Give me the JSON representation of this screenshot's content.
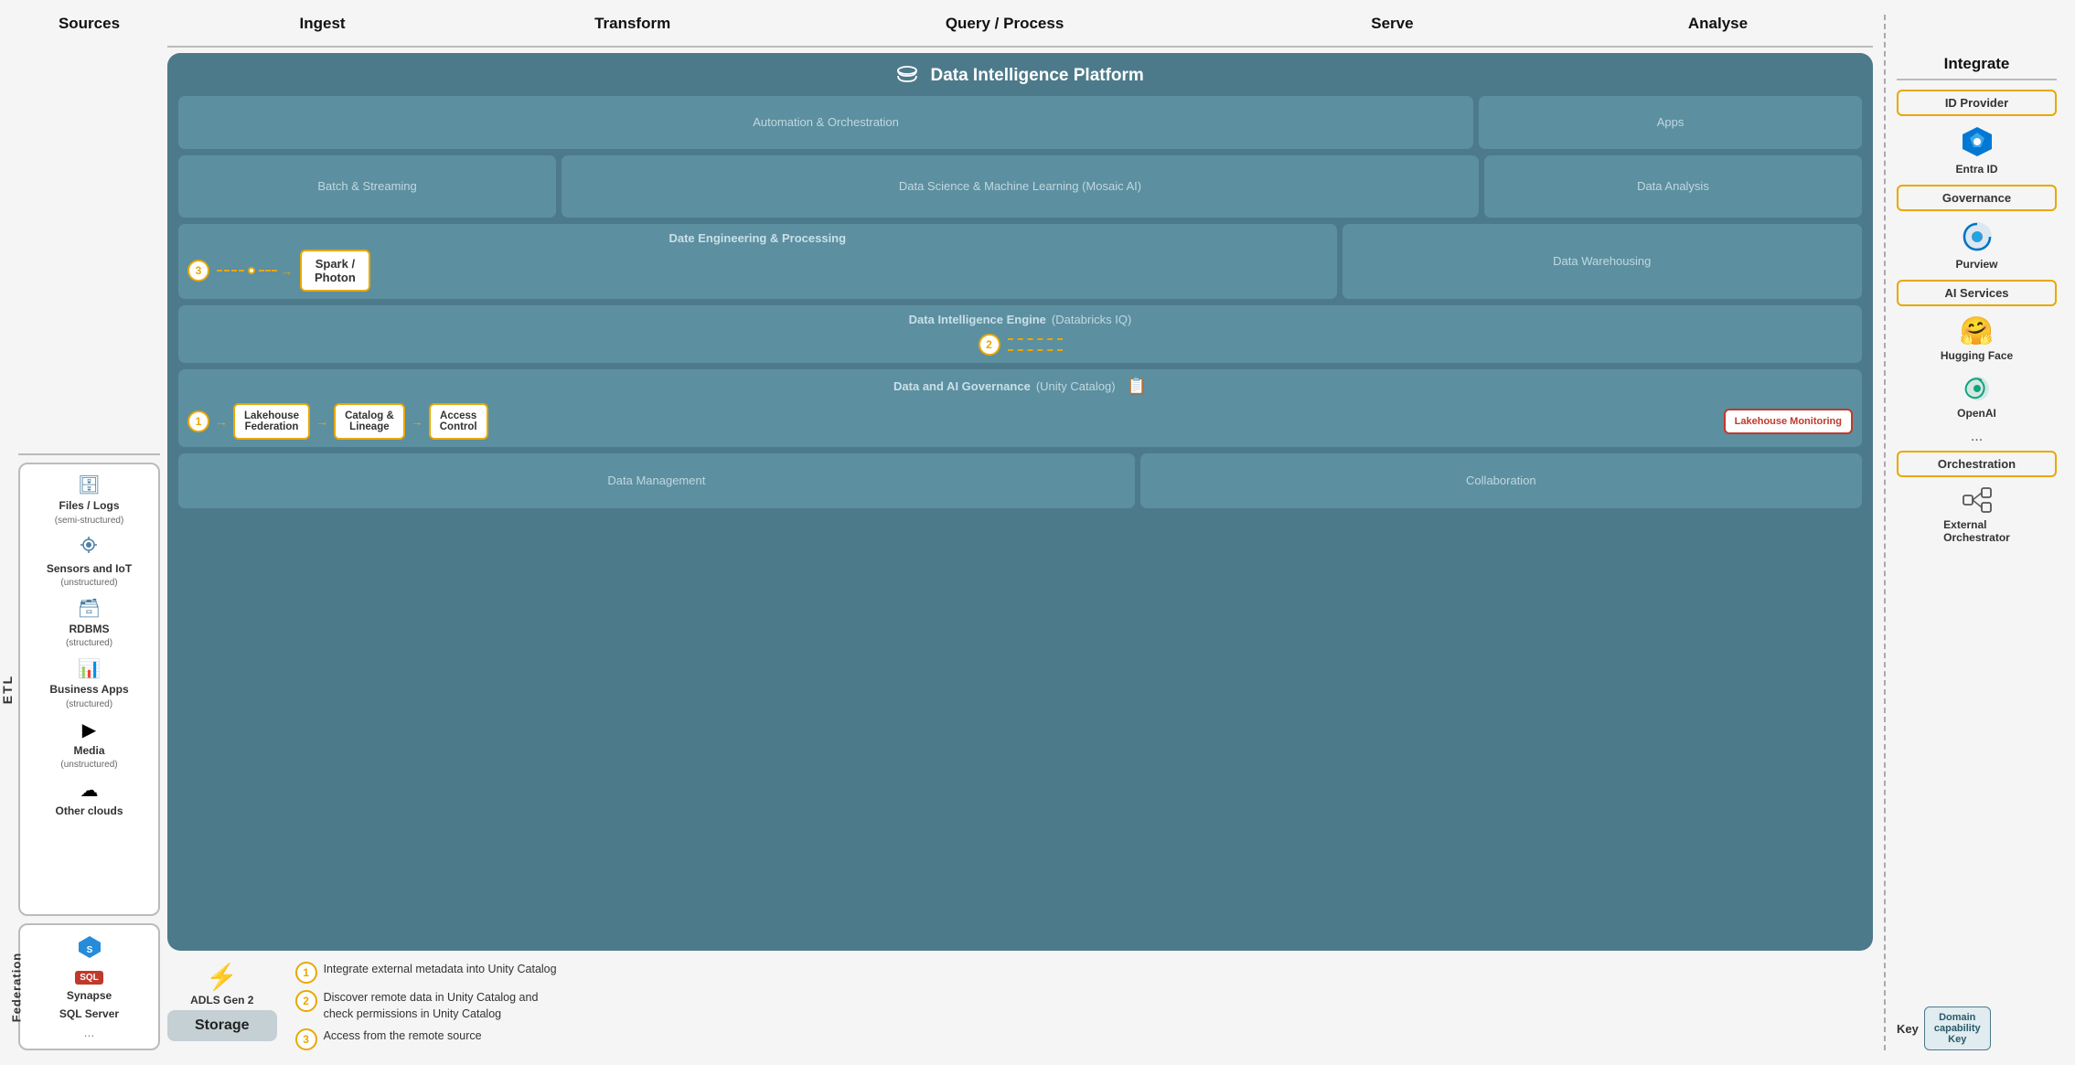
{
  "header": {
    "sources": "Sources",
    "ingest": "Ingest",
    "transform": "Transform",
    "query_process": "Query / Process",
    "serve": "Serve",
    "analyse": "Analyse",
    "integrate": "Integrate"
  },
  "sources": {
    "etl_label": "ETL",
    "items": [
      {
        "label": "Files / Logs",
        "sub": "(semi-structured)",
        "icon": "🗄"
      },
      {
        "label": "Sensors and IoT",
        "sub": "(unstructured)",
        "icon": "⚙"
      },
      {
        "label": "RDBMS",
        "sub": "(structured)",
        "icon": "🗃"
      },
      {
        "label": "Business Apps",
        "sub": "(structured)",
        "icon": "📊"
      },
      {
        "label": "Media",
        "sub": "(unstructured)",
        "icon": "▶"
      },
      {
        "label": "Other clouds",
        "sub": "",
        "icon": "☁"
      }
    ],
    "federation_label": "Federation",
    "fed_items": [
      {
        "label": "Synapse",
        "icon": "🔷"
      },
      {
        "label": "SQL Server",
        "icon": "🔴"
      }
    ],
    "fed_dots": "..."
  },
  "platform": {
    "title": "Data Intelligence Platform",
    "title_icon": "🗂",
    "automation": "Automation & Orchestration",
    "apps": "Apps",
    "batch_streaming": "Batch & Streaming",
    "data_science": "Data Science & Machine Learning  (Mosaic AI)",
    "data_analysis": "Data Analysis",
    "data_engineering_title": "Date Engineering & Processing",
    "spark_photon": "Spark /\nPhoton",
    "data_warehousing": "Data Warehousing",
    "engine_title": "Data Intelligence Engine",
    "engine_sub": "(Databricks IQ)",
    "governance_title": "Data and AI Governance",
    "governance_sub": "(Unity Catalog)",
    "governance_icon": "📋",
    "lakehouse_federation": "Lakehouse\nFederation",
    "catalog_lineage": "Catalog &\nLineage",
    "access_control": "Access\nControl",
    "lakehouse_monitoring": "Lakehouse\nMonitoring",
    "data_management": "Data Management",
    "collaboration": "Collaboration"
  },
  "storage": {
    "adls_label": "ADLS Gen 2",
    "adls_icon": "⚡",
    "storage_label": "Storage"
  },
  "legend": {
    "items": [
      {
        "num": "1",
        "text": "Integrate external metadata into Unity Catalog"
      },
      {
        "num": "2",
        "text": "Discover remote data in Unity Catalog and\ncheck permissions in Unity Catalog"
      },
      {
        "num": "3",
        "text": "Access from the remote source"
      }
    ]
  },
  "integrate": {
    "id_provider_label": "ID Provider",
    "entra_id_label": "Entra ID",
    "governance_label": "Governance",
    "purview_label": "Purview",
    "ai_services_label": "AI Services",
    "hugging_face_label": "Hugging Face",
    "openai_label": "OpenAI",
    "ai_dots": "...",
    "orchestration_label": "Orchestration",
    "ext_orchestrator_label": "External\nOrchestrator",
    "key_label": "Key",
    "domain_capability": "Domain\ncapability\nKey"
  }
}
